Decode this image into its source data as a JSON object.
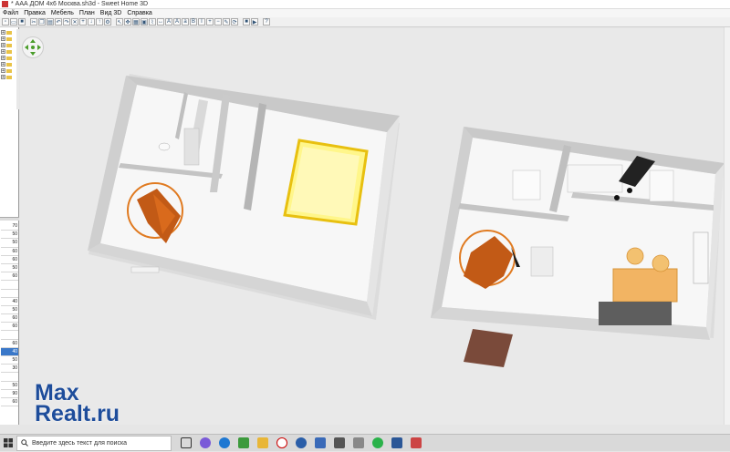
{
  "window": {
    "title": "* ААА ДОМ 4х6 Москва.sh3d - Sweet Home 3D"
  },
  "menu": [
    "Файл",
    "Правка",
    "Мебель",
    "План",
    "Вид 3D",
    "Справка"
  ],
  "left_panel": {
    "furniture_values": [
      "70",
      "50",
      "50",
      "60",
      "60",
      "50",
      "60",
      "",
      "",
      "40",
      "50",
      "60",
      "60",
      "",
      "60",
      "40",
      "50",
      "30",
      "",
      "50",
      "90",
      "60"
    ],
    "selected_row": 15
  },
  "taskbar": {
    "search_placeholder": "Введите здесь текст для поиска"
  },
  "watermark": {
    "line1": "Max",
    "line2": "Realt.ru"
  }
}
